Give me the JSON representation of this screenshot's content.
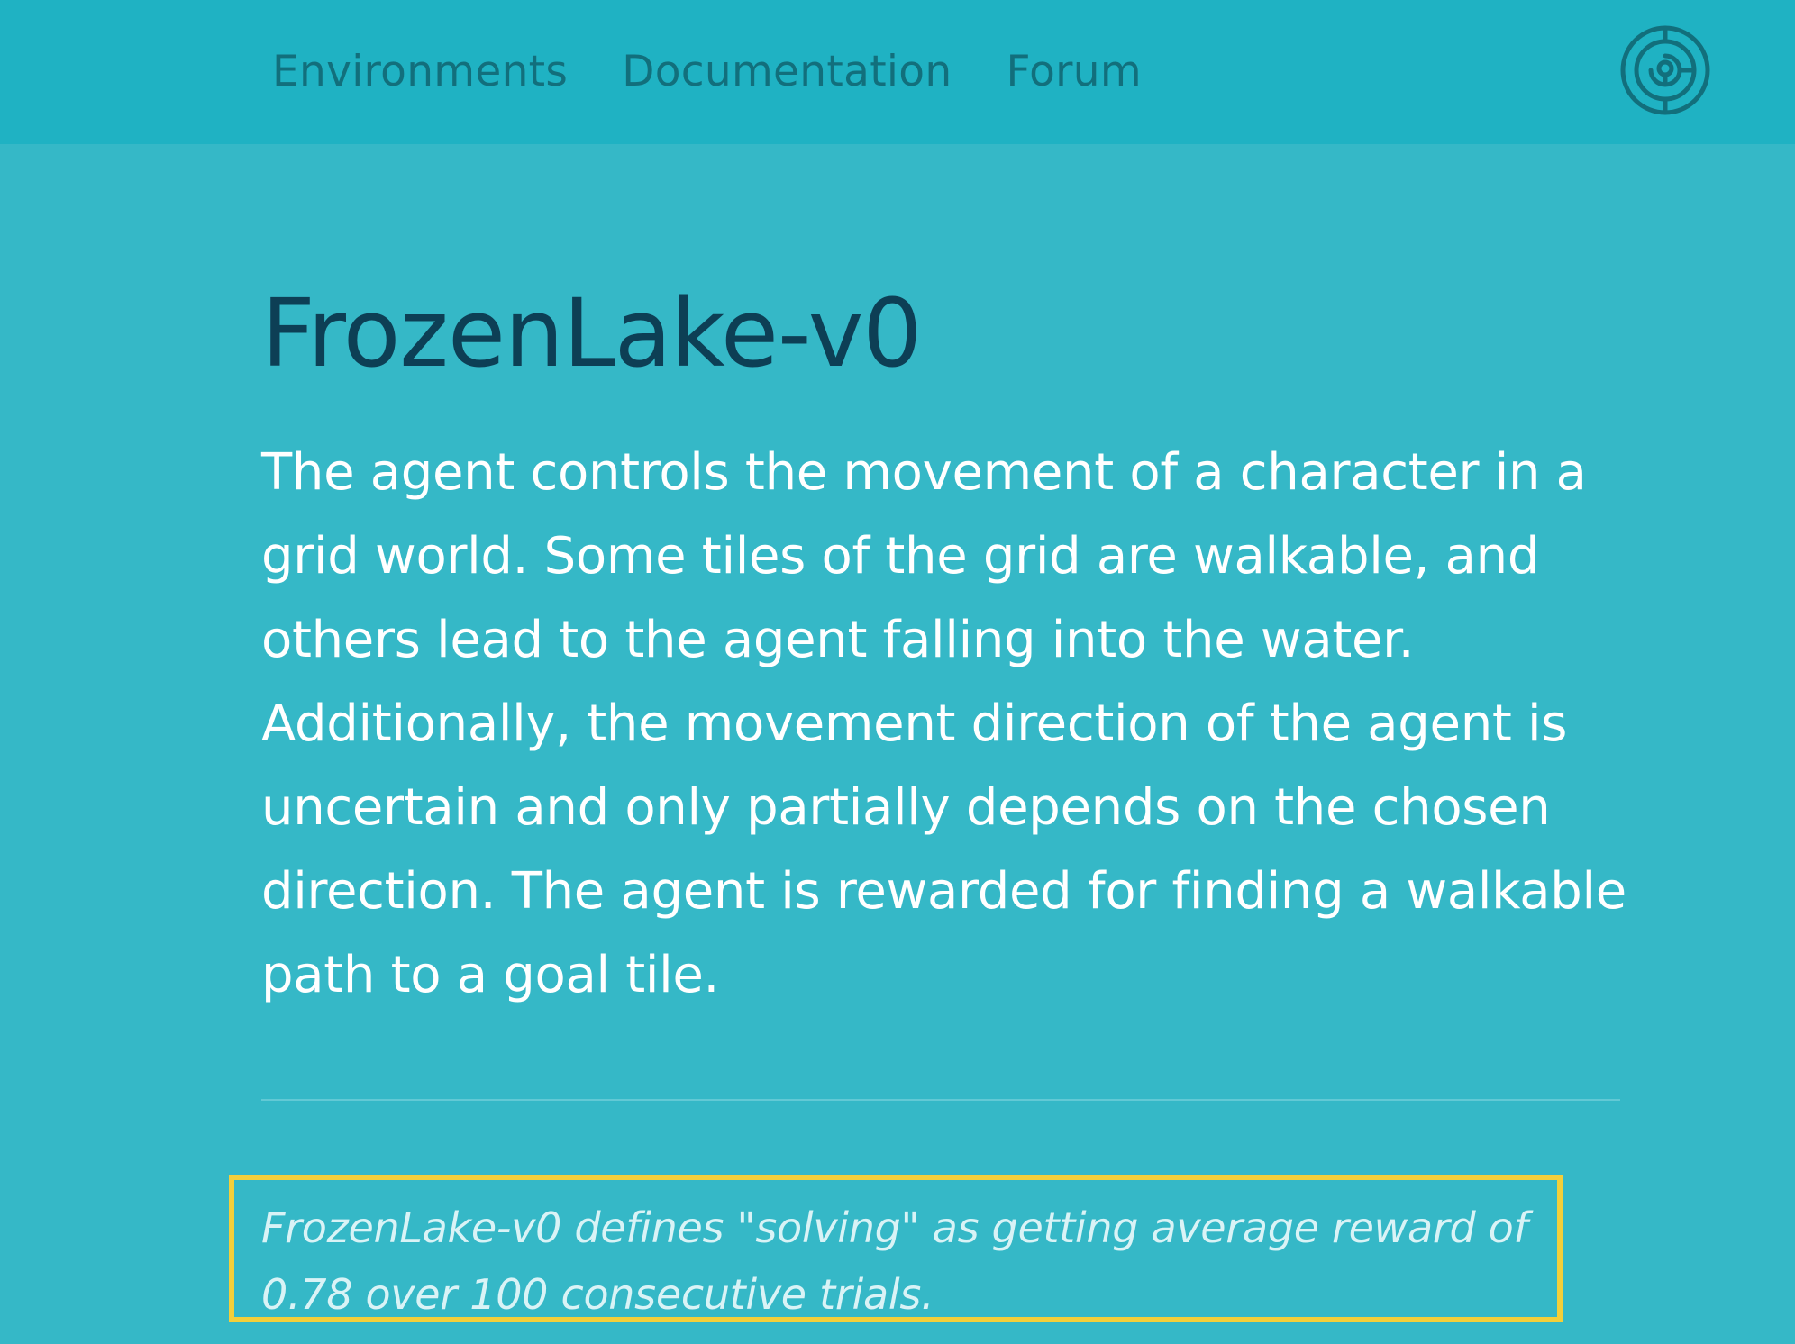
{
  "nav": {
    "items": [
      {
        "label": "Environments"
      },
      {
        "label": "Documentation"
      },
      {
        "label": "Forum"
      }
    ],
    "logo_icon": "gym-logo-icon"
  },
  "main": {
    "title": "FrozenLake-v0",
    "description": "The agent controls the movement of a character in a grid world. Some tiles of the grid are walkable, and others lead to the agent falling into the water. Additionally, the movement direction of the agent is uncertain and only partially depends on the chosen direction. The agent is rewarded for finding a walkable path to a goal tile.",
    "solving_note": "FrozenLake-v0 defines \"solving\" as getting average reward of 0.78 over 100 consecutive trials."
  },
  "colors": {
    "header_bg": "#1fb2c3",
    "page_bg": "#35b8c7",
    "title": "#0d3f55",
    "nav_text": "#126f7c",
    "highlight_border": "#f3cf3a"
  }
}
